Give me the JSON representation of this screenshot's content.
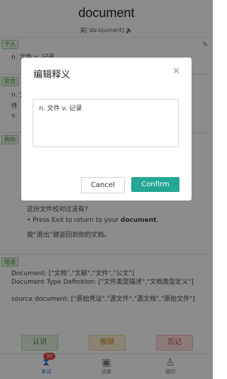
{
  "word": "document",
  "phonetic": "美[ˈdɑ:kjumənt]",
  "sections": {
    "personal": "个人",
    "official": "官方",
    "example": "例句",
    "phrases": "短语"
  },
  "official_lines": [
    "n. 文",
    "件",
    "v."
  ],
  "personal_line": "n. 文件 v. 记录",
  "example": {
    "cn_partial": "这份文件校对过没有?",
    "en_prefix": "• Press Exit to return to your ",
    "en_bold": "document",
    "en_suffix": ".",
    "cn": "按“退出”键返回到你的文档。"
  },
  "phrases": [
    "Document: [\"文档\",\"文献\",\"文件\",\"公文\"]",
    "Document Type Definition: [\"文件类型描述\",\"文档类型定义\"]",
    "source document: [\"原始凭证\",\"源文件\",\"源文档\",\"原始文件\"]"
  ],
  "actions": {
    "know": "认识",
    "vague": "模糊",
    "forget": "忘记"
  },
  "tabs": [
    {
      "label": "单词",
      "icon": "hourglass-icon"
    },
    {
      "label": "词库",
      "icon": "save-icon"
    },
    {
      "label": "我的",
      "icon": "user-icon"
    }
  ],
  "badge": "35",
  "dialog": {
    "title": "编辑释义",
    "text": "n. 文件 v. 记录",
    "cancel": "Cancel",
    "confirm": "Confirm"
  },
  "colors": {
    "accent": "#26a796",
    "tab_active": "#2c7bd0"
  }
}
